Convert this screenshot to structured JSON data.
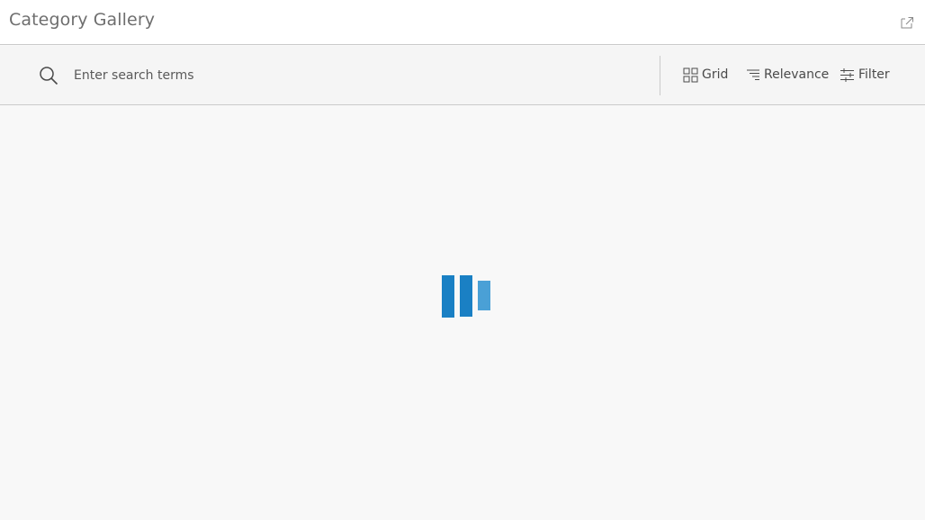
{
  "header": {
    "title": "Category Gallery",
    "share_icon": "share-export-icon"
  },
  "toolbar": {
    "search": {
      "placeholder": "Enter search terms",
      "value": "",
      "icon": "search-icon"
    },
    "grid_label": "Grid",
    "relevance_label": "Relevance",
    "filter_label": "Filter"
  },
  "content": {
    "state": "loading",
    "loader_icon": "loading-bars-icon"
  },
  "colors": {
    "accent": "#1a80c4",
    "accent_light": "#4aa0d6",
    "header_bg": "#ffffff",
    "toolbar_bg": "#f5f5f5",
    "page_bg": "#f8f8f8",
    "border": "#cacaca"
  }
}
